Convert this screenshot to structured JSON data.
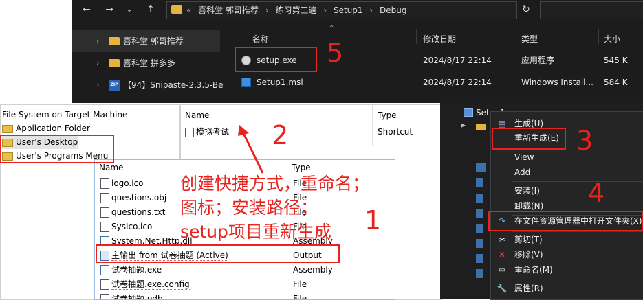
{
  "explorer": {
    "back_icon": "←",
    "forward_icon": "→",
    "dropdown_icon": "⌄",
    "up_icon": "↑",
    "breadcrumbs": [
      "«",
      "喜科堂 郭哥推荐",
      "›",
      "练习第三遍",
      "›",
      "Setup1",
      "›",
      "Debug"
    ],
    "address_dropdown_icon": "⌄",
    "refresh_icon": "↻",
    "nav_items": [
      {
        "label": "喜科堂 郭哥推荐",
        "icon": "folder-icon"
      },
      {
        "label": "喜科堂 拼多多",
        "icon": "folder-icon"
      },
      {
        "label": "【94】Snipaste-2.3.5-Be",
        "icon": "zip-icon"
      }
    ],
    "zip_badge": "ZIP",
    "sort_icon": "^",
    "columns": {
      "name": "名称",
      "date": "修改日期",
      "type": "类型",
      "size": "大小"
    },
    "files": [
      {
        "name": "setup.exe",
        "date": "2024/8/17 22:14",
        "type": "应用程序",
        "size": "545 K"
      },
      {
        "name": "Setup1.msi",
        "date": "2024/8/17 22:14",
        "type": "Windows Install...",
        "size": "584 K"
      }
    ]
  },
  "filesystem": {
    "root": "File System on Target Machine",
    "folders": [
      "Application Folder",
      "User's Desktop",
      "User's Programs Menu"
    ],
    "right_headers": {
      "name": "Name",
      "type": "Type"
    },
    "right_rows": [
      {
        "name": "模拟考试",
        "type": "Shortcut"
      }
    ]
  },
  "assemblies": {
    "headers": {
      "name": "Name",
      "type": "Type"
    },
    "rows": [
      {
        "name": "logo.ico",
        "type": "File"
      },
      {
        "name": "questions.obj",
        "type": "File"
      },
      {
        "name": "questions.txt",
        "type": "File"
      },
      {
        "name": "SysIco.ico",
        "type": "File"
      },
      {
        "name": "System.Net.Http.dll",
        "type": "Assembly"
      },
      {
        "name": "主输出 from 试卷抽题 (Active)",
        "type": "Output"
      },
      {
        "name": "试卷抽题.exe",
        "type": "Assembly"
      },
      {
        "name": "试卷抽题.exe.config",
        "type": "File"
      },
      {
        "name": "试卷抽题.pdb",
        "type": "File"
      }
    ]
  },
  "vs": {
    "node_label": "Setup1",
    "menu": [
      {
        "label": "生成(U)",
        "icon": "build-icon"
      },
      {
        "label": "重新生成(E)",
        "icon": ""
      },
      {
        "label": "View",
        "icon": ""
      },
      {
        "label": "Add",
        "icon": ""
      },
      {
        "label": "安装(I)",
        "icon": ""
      },
      {
        "label": "卸载(N)",
        "icon": ""
      },
      {
        "label": "在文件资源管理器中打开文件夹(X)",
        "icon": "open-folder-icon"
      },
      {
        "label": "剪切(T)",
        "icon": "cut-icon"
      },
      {
        "label": "移除(V)",
        "icon": "remove-icon"
      },
      {
        "label": "重命名(M)",
        "icon": "rename-icon"
      },
      {
        "label": "属性(R)",
        "icon": "properties-icon"
      }
    ]
  },
  "annotations": {
    "numbers": [
      "5",
      "2",
      "3",
      "4",
      "1"
    ],
    "text_lines": [
      "创建快捷方式，重命名；",
      "图标；安装路径；",
      "setup项目重新生成"
    ]
  },
  "colors": {
    "annotation_red": "#e8231e",
    "explorer_bg": "#1c1c1c",
    "vs_bg": "#1e1e1e",
    "folder_yellow": "#e6b341"
  }
}
